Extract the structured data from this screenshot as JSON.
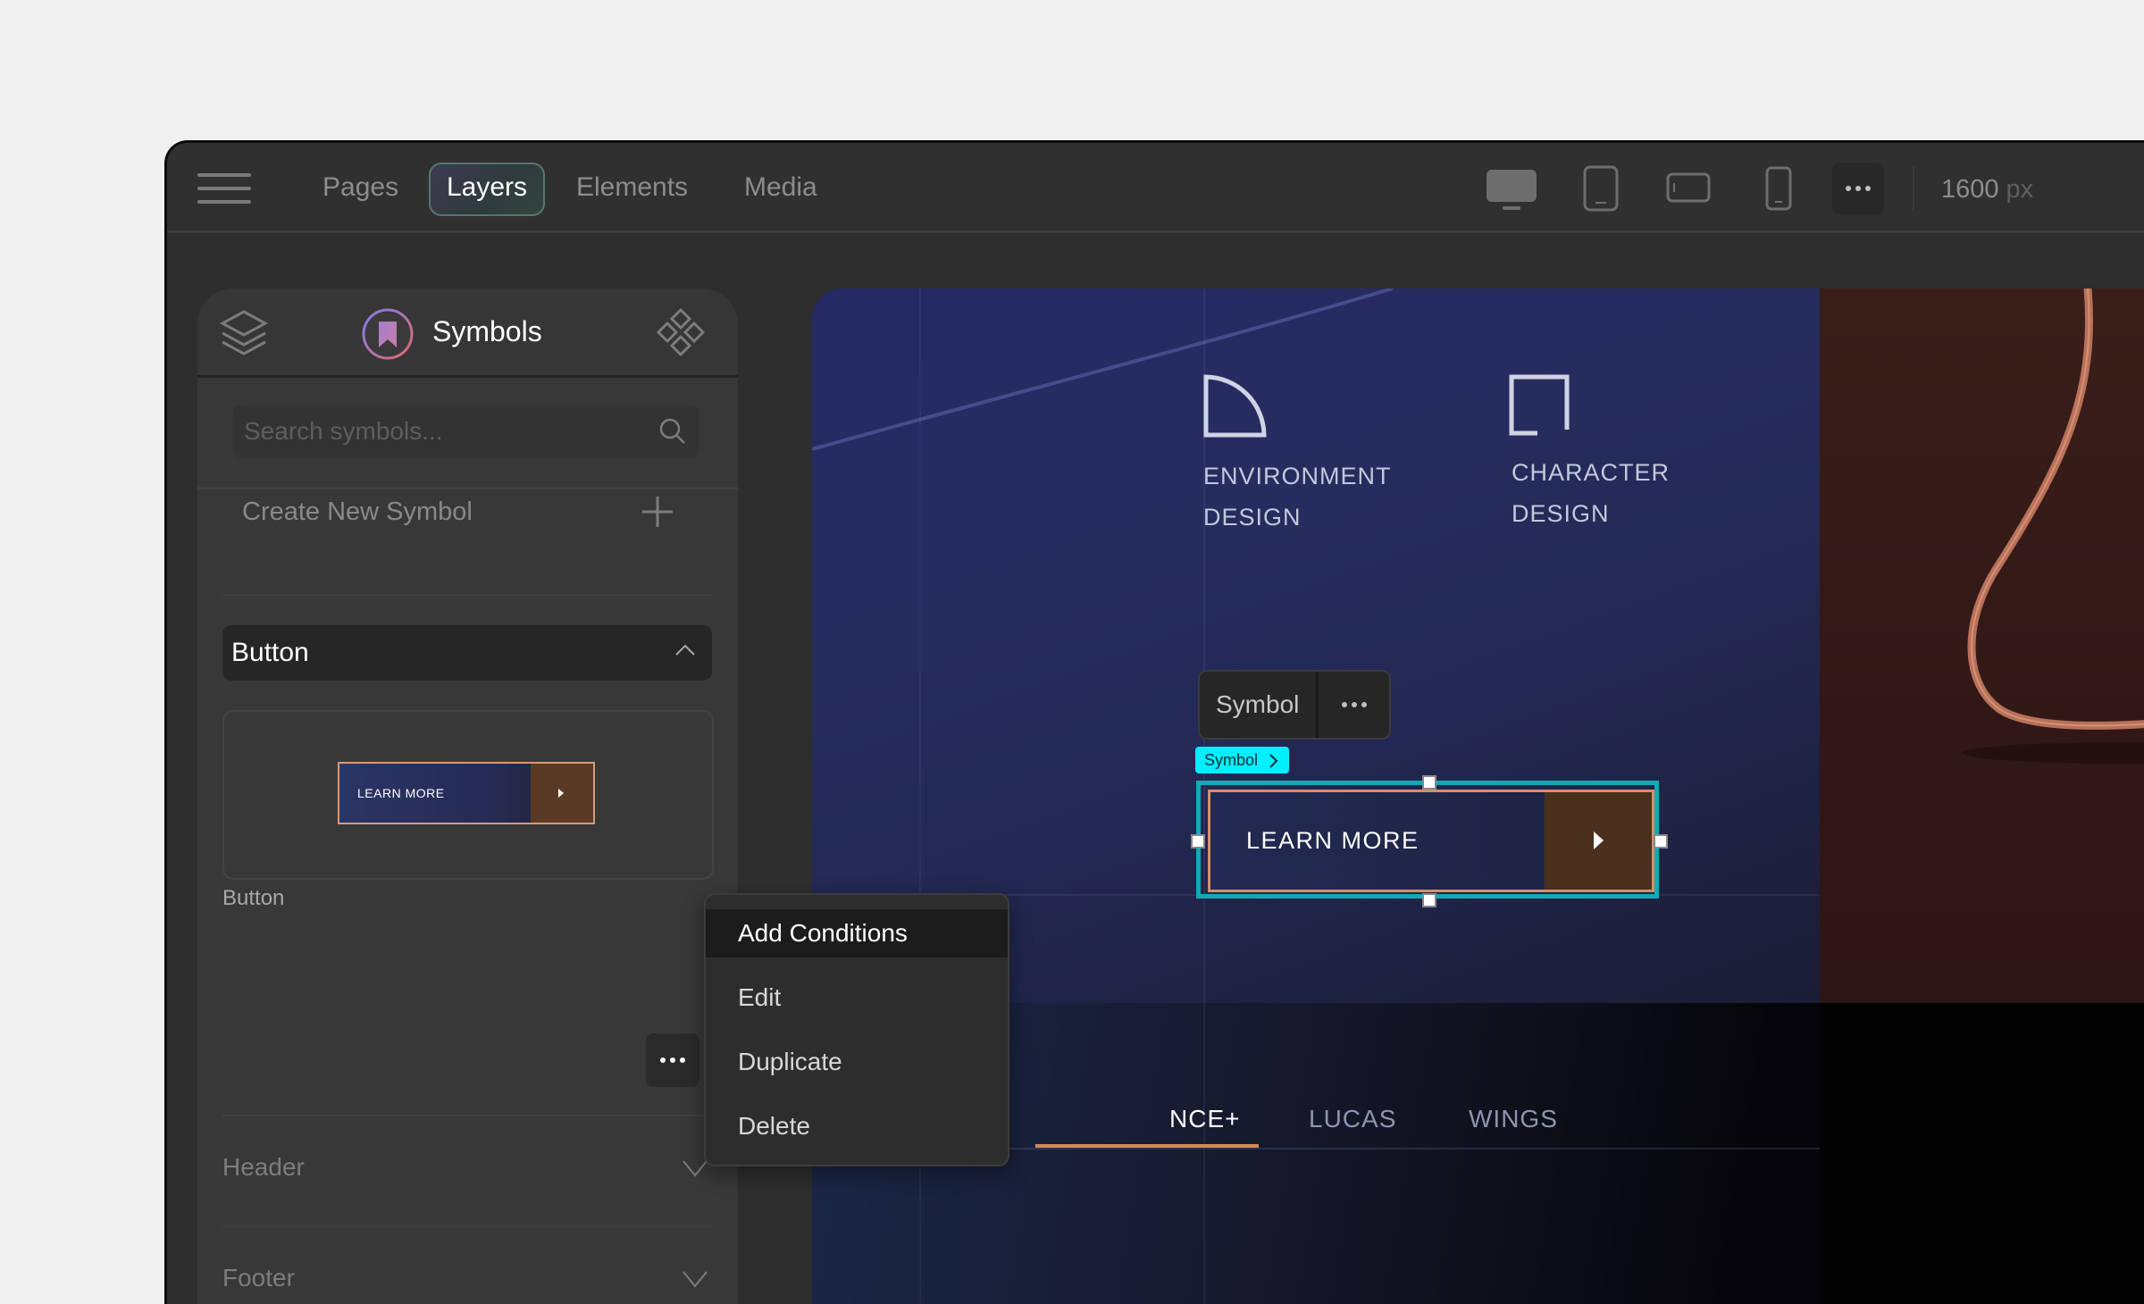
{
  "toolbar": {
    "tabs": [
      {
        "label": "Pages",
        "active": false
      },
      {
        "label": "Layers",
        "active": true
      },
      {
        "label": "Elements",
        "active": false
      },
      {
        "label": "Media",
        "active": false
      }
    ],
    "devices": [
      "desktop",
      "tablet-portrait",
      "tablet-landscape",
      "phone"
    ],
    "active_device": "desktop",
    "width_value": "1600",
    "width_unit": "px"
  },
  "sidebar": {
    "title": "Symbols",
    "search": {
      "placeholder": "Search symbols...",
      "value": ""
    },
    "create_label": "Create New Symbol",
    "sections": [
      {
        "label": "Button",
        "expanded": true,
        "items": [
          {
            "name": "Button",
            "preview_label": "LEARN MORE"
          }
        ]
      },
      {
        "label": "Header",
        "expanded": false
      },
      {
        "label": "Footer",
        "expanded": false
      }
    ]
  },
  "context_menu": {
    "items": [
      {
        "label": "Add Conditions",
        "highlighted": true
      },
      {
        "label": "Edit"
      },
      {
        "label": "Duplicate"
      },
      {
        "label": "Delete"
      }
    ]
  },
  "canvas": {
    "features": [
      {
        "title_line1": "ENVIRONMENT",
        "title_line2": "DESIGN"
      },
      {
        "title_line1": "CHARACTER",
        "title_line2": "DESIGN"
      }
    ],
    "symbol_toolbar_label": "Symbol",
    "symbol_tag_label": "Symbol",
    "cta_label": "LEARN MORE",
    "nav_tabs": [
      {
        "label": "NCE+",
        "active": true
      },
      {
        "label": "LUCAS",
        "active": false
      },
      {
        "label": "WINGS",
        "active": false
      }
    ]
  },
  "colors": {
    "selection": "#14a9b5",
    "symbol_tag": "#00f0ff",
    "accent_copper": "#d09070"
  }
}
